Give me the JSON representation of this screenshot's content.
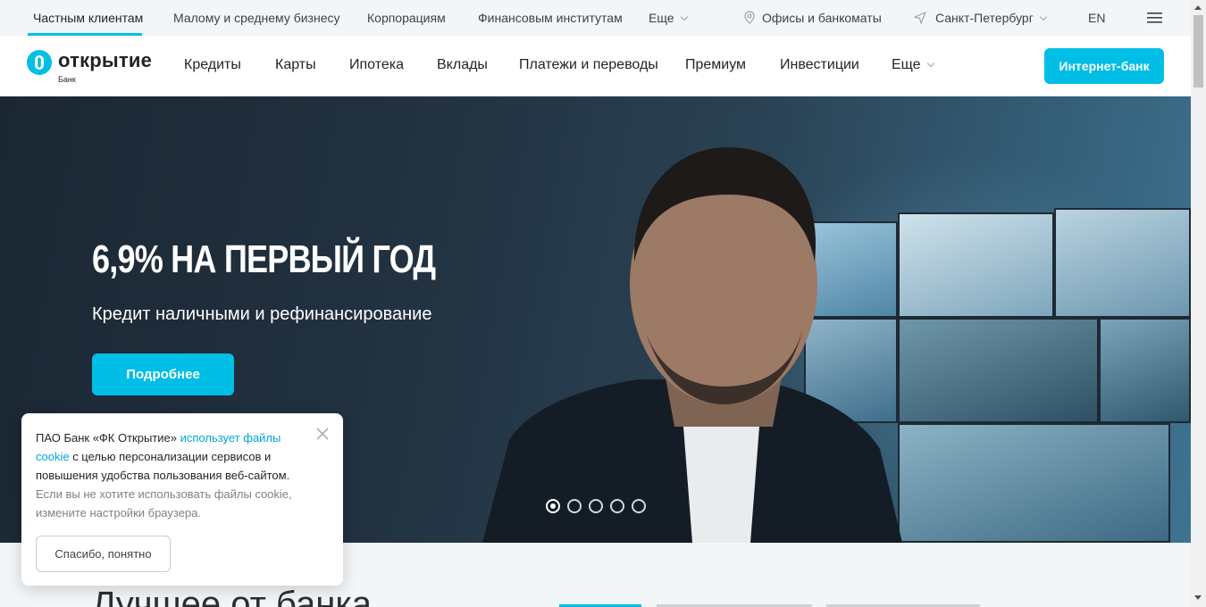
{
  "topbar": {
    "segments": [
      {
        "label": "Частным клиентам",
        "active": true
      },
      {
        "label": "Малому и среднему бизнесу"
      },
      {
        "label": "Корпорациям"
      },
      {
        "label": "Финансовым институтам"
      },
      {
        "label": "Еще"
      }
    ],
    "offices_label": "Офисы и банкоматы",
    "city_label": "Санкт-Петербург",
    "lang_label": "EN",
    "accent_color": "#00bee6"
  },
  "logo": {
    "word": "открытие",
    "sub": "Банк"
  },
  "mainnav": {
    "items": [
      "Кредиты",
      "Карты",
      "Ипотека",
      "Вклады",
      "Платежи и переводы",
      "Премиум",
      "Инвестиции",
      "Еще"
    ],
    "internet_bank_label": "Интернет-банк"
  },
  "hero": {
    "headline": "6,9% НА ПЕРВЫЙ ГОД",
    "subline": "Кредит наличными и рефинансирование",
    "button_label": "Подробнее",
    "slides_total": 5,
    "active_slide": 1
  },
  "cookie": {
    "text_part1": "ПАО Банк «ФК Открытие» ",
    "link_text": "использует файлы cookie",
    "text_part2": " с целью персонализации сервисов и повышения удобства пользования веб-сайтом. ",
    "muted_text": "Если вы не хотите использовать файлы cookie, измените настройки браузера.",
    "button_label": "Спасибо, понятно"
  },
  "bottom": {
    "title": "Лучшее от банка"
  },
  "icons": [
    "location-pin-icon",
    "navigation-arrow-icon",
    "hamburger-menu-icon",
    "close-icon",
    "chevron-down-icon"
  ]
}
